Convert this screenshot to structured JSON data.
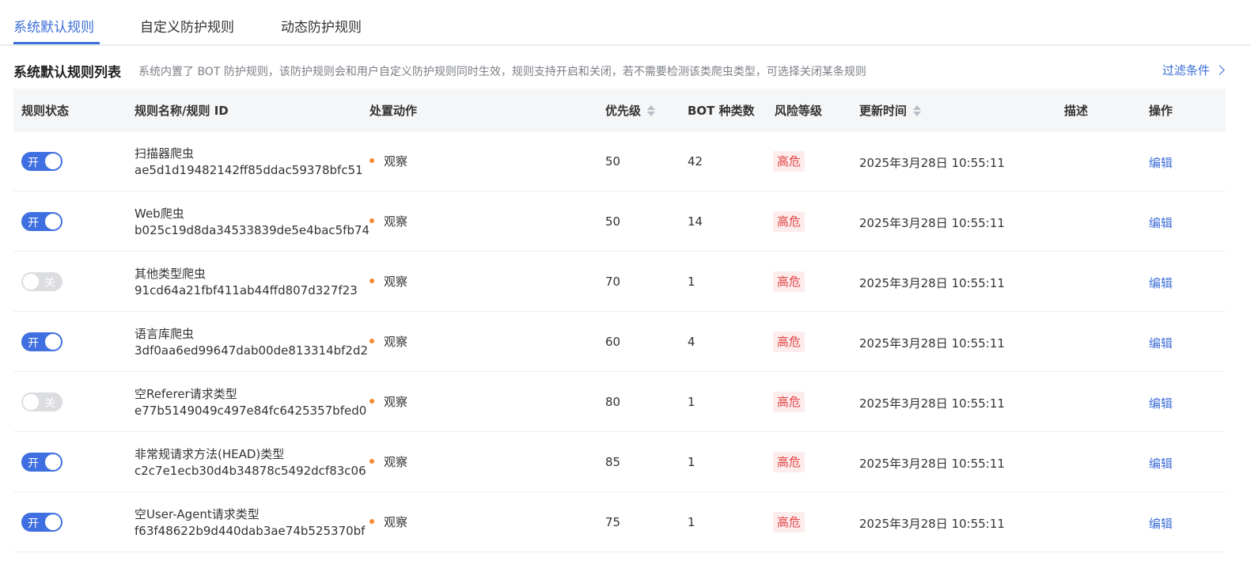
{
  "tabs": [
    {
      "label": "系统默认规则",
      "active": true
    },
    {
      "label": "自定义防护规则",
      "active": false
    },
    {
      "label": "动态防护规则",
      "active": false
    }
  ],
  "section": {
    "title": "系统默认规则列表",
    "description": "系统内置了 BOT 防护规则，该防护规则会和用户自定义防护规则同时生效，规则支持开启和关闭，若不需要检测该类爬虫类型，可选择关闭某条规则",
    "filter_label": "过滤条件"
  },
  "table": {
    "headers": {
      "status": "规则状态",
      "name": "规则名称/规则 ID",
      "action": "处置动作",
      "priority": "优先级",
      "bot_count": "BOT 种类数",
      "risk": "风险等级",
      "updated": "更新时间",
      "description": "描述",
      "operation": "操作"
    },
    "rows": [
      {
        "enabled": true,
        "toggle_label": "开",
        "name": "扫描器爬虫",
        "id": "ae5d1d19482142ff85ddac59378bfc51",
        "action": "观察",
        "priority": "50",
        "bot_count": "42",
        "risk": "高危",
        "updated": "2025年3月28日 10:55:11",
        "operation": "编辑"
      },
      {
        "enabled": true,
        "toggle_label": "开",
        "name": "Web爬虫",
        "id": "b025c19d8da34533839de5e4bac5fb74",
        "action": "观察",
        "priority": "50",
        "bot_count": "14",
        "risk": "高危",
        "updated": "2025年3月28日 10:55:11",
        "operation": "编辑"
      },
      {
        "enabled": false,
        "toggle_label": "关",
        "name": "其他类型爬虫",
        "id": "91cd64a21fbf411ab44ffd807d327f23",
        "action": "观察",
        "priority": "70",
        "bot_count": "1",
        "risk": "高危",
        "updated": "2025年3月28日 10:55:11",
        "operation": "编辑"
      },
      {
        "enabled": true,
        "toggle_label": "开",
        "name": "语言库爬虫",
        "id": "3df0aa6ed99647dab00de813314bf2d2",
        "action": "观察",
        "priority": "60",
        "bot_count": "4",
        "risk": "高危",
        "updated": "2025年3月28日 10:55:11",
        "operation": "编辑"
      },
      {
        "enabled": false,
        "toggle_label": "关",
        "name": "空Referer请求类型",
        "id": "e77b5149049c497e84fc6425357bfed0",
        "action": "观察",
        "priority": "80",
        "bot_count": "1",
        "risk": "高危",
        "updated": "2025年3月28日 10:55:11",
        "operation": "编辑"
      },
      {
        "enabled": true,
        "toggle_label": "开",
        "name": "非常规请求方法(HEAD)类型",
        "id": "c2c7e1ecb30d4b34878c5492dcf83c06",
        "action": "观察",
        "priority": "85",
        "bot_count": "1",
        "risk": "高危",
        "updated": "2025年3月28日 10:55:11",
        "operation": "编辑"
      },
      {
        "enabled": true,
        "toggle_label": "开",
        "name": "空User-Agent请求类型",
        "id": "f63f48622b9d440dab3ae74b525370bf",
        "action": "观察",
        "priority": "75",
        "bot_count": "1",
        "risk": "高危",
        "updated": "2025年3月28日 10:55:11",
        "operation": "编辑"
      }
    ]
  },
  "colors": {
    "accent": "#3d6ed8",
    "toggle_on": "#3f6fe0",
    "toggle_off": "#dcdde0",
    "risk_text": "#e24545",
    "risk_bg": "#fdecec",
    "action_dot": "#f5892f"
  }
}
